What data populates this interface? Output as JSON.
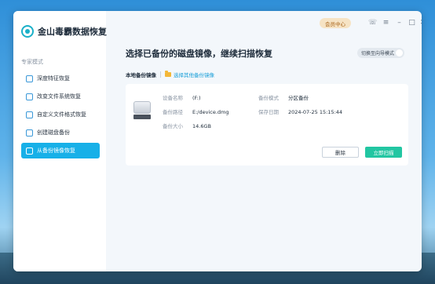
{
  "app": {
    "name": "金山毒霸数据恢复"
  },
  "sidebar": {
    "section_label": "专家模式",
    "items": [
      {
        "label": "深度特征恢复",
        "icon": "deep-scan-icon"
      },
      {
        "label": "改变文件系统恢复",
        "icon": "filesystem-icon"
      },
      {
        "label": "自定义文件格式恢复",
        "icon": "custom-format-icon"
      },
      {
        "label": "创建磁盘备份",
        "icon": "disk-backup-icon"
      },
      {
        "label": "从备份镜像恢复",
        "icon": "image-restore-icon",
        "active": true
      }
    ]
  },
  "header": {
    "vip_label": "会员中心",
    "window_buttons": [
      "support-icon",
      "menu-icon",
      "minimize-icon",
      "maximize-icon",
      "close-icon"
    ]
  },
  "main": {
    "title": "选择已备份的磁盘镜像，继续扫描恢复",
    "mode_toggle_label": "切换至向导模式",
    "tabs": {
      "local": "本地备份镜像",
      "other": "选择其他备份镜像"
    },
    "backup": {
      "device_name_label": "设备名称",
      "device_name": "(F:)",
      "path_label": "备份路径",
      "path": "E:/device.dmg",
      "size_label": "备份大小",
      "size": "14.6GB",
      "mode_label": "备份模式",
      "mode": "分区备份",
      "date_label": "保存日期",
      "date": "2024-07-25 15:15:44"
    },
    "buttons": {
      "delete": "删除",
      "scan": "立即扫描"
    }
  },
  "colors": {
    "accent": "#17b0e8",
    "scan_button": "#22c6a2",
    "vip_badge": "#f6e3c4"
  }
}
